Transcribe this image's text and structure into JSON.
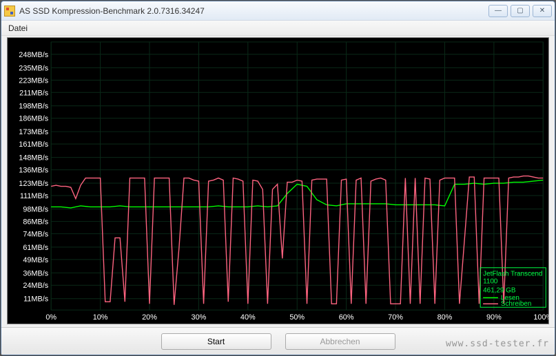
{
  "window": {
    "title": "AS SSD Kompression-Benchmark 2.0.7316.34247",
    "controls": {
      "min": "—",
      "max": "▢",
      "close": "✕"
    }
  },
  "menu": {
    "file_label": "Datei"
  },
  "footer": {
    "start_label": "Start",
    "cancel_label": "Abbrechen"
  },
  "legend": {
    "device": "JetFlash Transcend 1100",
    "capacity": "461,29 GB",
    "read_label": "Lesen",
    "write_label": "Schreiben"
  },
  "watermark": "www.ssd-tester.fr",
  "chart_data": {
    "type": "line",
    "xlabel": "",
    "ylabel": "",
    "x_ticks": [
      "0%",
      "10%",
      "20%",
      "30%",
      "40%",
      "50%",
      "60%",
      "70%",
      "80%",
      "90%",
      "100%"
    ],
    "y_ticks": [
      "11MB/s",
      "24MB/s",
      "36MB/s",
      "49MB/s",
      "61MB/s",
      "74MB/s",
      "86MB/s",
      "98MB/s",
      "111MB/s",
      "123MB/s",
      "136MB/s",
      "148MB/s",
      "161MB/s",
      "173MB/s",
      "186MB/s",
      "198MB/s",
      "211MB/s",
      "223MB/s",
      "235MB/s",
      "248MB/s"
    ],
    "ylim": [
      0,
      260
    ],
    "xlim": [
      0,
      100
    ],
    "series": [
      {
        "name": "Lesen",
        "color": "#00ff00",
        "x": [
          0,
          2,
          4,
          6,
          8,
          10,
          12,
          14,
          16,
          18,
          20,
          22,
          24,
          26,
          28,
          30,
          32,
          34,
          36,
          38,
          40,
          42,
          44,
          46,
          48,
          50,
          52,
          54,
          56,
          58,
          60,
          62,
          64,
          66,
          68,
          70,
          72,
          74,
          76,
          78,
          80,
          82,
          84,
          86,
          88,
          90,
          92,
          94,
          96,
          98,
          100
        ],
        "values": [
          100,
          100,
          99,
          101,
          100,
          100,
          100,
          101,
          100,
          100,
          100,
          100,
          100,
          100,
          100,
          100,
          100,
          101,
          100,
          100,
          100,
          101,
          100,
          101,
          113,
          122,
          120,
          107,
          102,
          101,
          103,
          103,
          103,
          103,
          103,
          102,
          102,
          102,
          102,
          102,
          101,
          122,
          122,
          123,
          122,
          123,
          123,
          124,
          124,
          125,
          126
        ]
      },
      {
        "name": "Schreiben",
        "color": "#ff6480",
        "x": [
          0,
          1,
          2,
          3,
          4,
          5,
          6,
          7,
          8,
          9,
          10,
          11,
          12,
          13,
          14,
          15,
          16,
          17,
          18,
          19,
          20,
          21,
          22,
          23,
          24,
          25,
          26,
          27,
          28,
          29,
          30,
          31,
          32,
          33,
          34,
          35,
          36,
          37,
          38,
          39,
          40,
          41,
          42,
          43,
          44,
          45,
          46,
          47,
          48,
          49,
          50,
          51,
          52,
          53,
          54,
          55,
          56,
          57,
          58,
          59,
          60,
          61,
          62,
          63,
          64,
          65,
          66,
          67,
          68,
          69,
          70,
          71,
          72,
          73,
          74,
          75,
          76,
          77,
          78,
          79,
          80,
          81,
          82,
          83,
          84,
          85,
          86,
          87,
          88,
          89,
          90,
          91,
          92,
          93,
          94,
          95,
          96,
          97,
          98,
          99,
          100
        ],
        "values": [
          120,
          121,
          120,
          120,
          119,
          108,
          121,
          128,
          128,
          128,
          128,
          8,
          8,
          70,
          70,
          8,
          128,
          128,
          128,
          128,
          6,
          128,
          128,
          128,
          128,
          5,
          60,
          128,
          128,
          126,
          125,
          6,
          125,
          126,
          128,
          126,
          8,
          128,
          127,
          125,
          6,
          126,
          125,
          117,
          6,
          117,
          122,
          50,
          124,
          124,
          126,
          125,
          6,
          126,
          127,
          127,
          127,
          6,
          6,
          126,
          127,
          6,
          126,
          128,
          6,
          125,
          127,
          128,
          126,
          6,
          6,
          6,
          128,
          6,
          128,
          6,
          128,
          127,
          6,
          126,
          128,
          128,
          128,
          6,
          67,
          129,
          129,
          6,
          128,
          128,
          128,
          128,
          6,
          128,
          129,
          129,
          130,
          130,
          129,
          128,
          128
        ]
      }
    ]
  }
}
